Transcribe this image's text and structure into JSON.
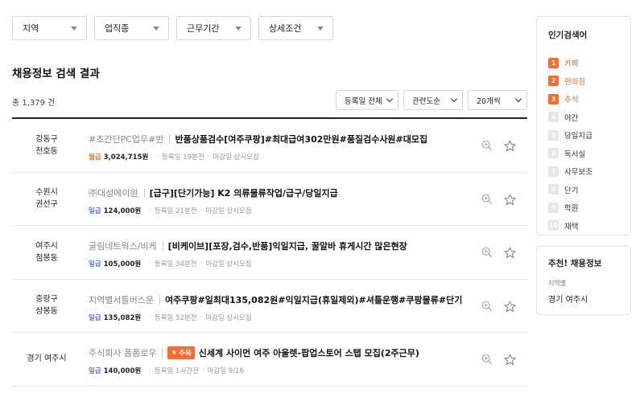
{
  "filters": [
    {
      "label": "지역"
    },
    {
      "label": "업직종"
    },
    {
      "label": "근무기간"
    },
    {
      "label": "상세조건"
    }
  ],
  "results": {
    "title": "채용정보 검색 결과",
    "total": "총 1,379 건",
    "sort_options": [
      {
        "label": "등록일 전체"
      },
      {
        "label": "관련도순"
      },
      {
        "label": "20개씩"
      }
    ]
  },
  "jobs": [
    {
      "loc1": "강동구",
      "loc2": "천호동",
      "company": "#초간단PC업무#반",
      "badge": "",
      "title": "반품상품검수[여주쿠팡]#최대급여302만원#품질검수사원#대모집",
      "pay_type": "월급",
      "pay_class": "month",
      "pay": "3,024,715원",
      "registered": "등록일 19분전",
      "deadline": "마감일 상시모집"
    },
    {
      "loc1": "수원시",
      "loc2": "권선구",
      "company": "㈜대성에이원",
      "badge": "",
      "title": "[급구][단기가능] K2 의류물류작업/급구/당일지급",
      "pay_type": "일급",
      "pay_class": "day",
      "pay": "124,000원",
      "registered": "등록일 21분전",
      "deadline": "마감일 상시모집"
    },
    {
      "loc1": "여주시",
      "loc2": "점봉동",
      "company": "굴림네트웍스/비케",
      "badge": "",
      "title": "[비케이브][포장,검수,반품]익일지급, 꿀알바 휴게시간 많은현장",
      "pay_type": "일급",
      "pay_class": "day",
      "pay": "105,000원",
      "registered": "등록일 34분전",
      "deadline": "마감일 상시모집"
    },
    {
      "loc1": "중랑구",
      "loc2": "상봉동",
      "company": "지역별서틀버스운",
      "badge": "",
      "title": "여주쿠팡#일최대135,082원#익일지급(휴일제외)#셔틀운행#쿠팡물류#단기",
      "pay_type": "일급",
      "pay_class": "day",
      "pay": "135,082원",
      "registered": "등록일 52분전",
      "deadline": "마감일 상시모집"
    },
    {
      "loc1": "경기 여주시",
      "loc2": "",
      "company": "주식회사 폼폼로우",
      "badge": "주목",
      "title": "신세계 사이먼 여주 아울렛-팝업스토어 스탭 모집(2주근무)",
      "pay_type": "일급",
      "pay_class": "day",
      "pay": "140,000원",
      "registered": "등록일 1시간전",
      "deadline": "마감일 9/16"
    }
  ],
  "popular": {
    "title": "인기검색어",
    "keywords": [
      {
        "rank": "1",
        "text": "카페"
      },
      {
        "rank": "2",
        "text": "편의점"
      },
      {
        "rank": "3",
        "text": "추석"
      },
      {
        "rank": "4",
        "text": "야간"
      },
      {
        "rank": "5",
        "text": "당일지급"
      },
      {
        "rank": "6",
        "text": "독서실"
      },
      {
        "rank": "7",
        "text": "사무보조"
      },
      {
        "rank": "8",
        "text": "단기"
      },
      {
        "rank": "9",
        "text": "학원"
      },
      {
        "rank": "10",
        "text": "재택"
      }
    ]
  },
  "recommend": {
    "title": "추천! 채용정보",
    "label": "지역별",
    "value": "경기 여주시"
  },
  "colors": {
    "accent": "#ff6a2b",
    "daily": "#5b7ad8",
    "monthly": "#f07a1a"
  },
  "icons": {
    "zoom": "zoom-in-icon",
    "star": "star-icon"
  }
}
